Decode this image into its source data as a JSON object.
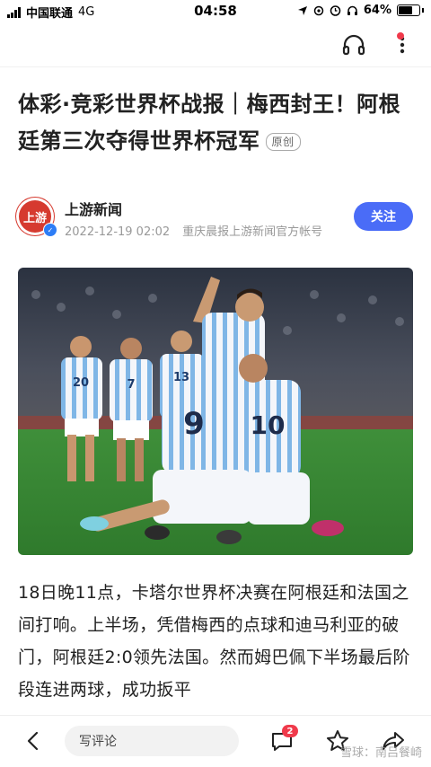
{
  "status_bar": {
    "carrier": "中国联通",
    "network": "4G",
    "time": "04:58",
    "battery": "64%"
  },
  "article": {
    "title": "体彩·竞彩世界杯战报｜梅西封王！阿根廷第三次夺得世界杯冠军",
    "original_tag": "原创",
    "body": "18日晚11点，卡塔尔世界杯决赛在阿根廷和法国之间打响。上半场，凭借梅西的点球和迪马利亚的破门，阿根廷2:0领先法国。然而姆巴佩下半场最后阶段连进两球，成功扳平"
  },
  "author": {
    "avatar_text": "上游",
    "name": "上游新闻",
    "date": "2022-12-19 02:02",
    "description": "重庆晨报上游新闻官方帐号",
    "follow_label": "关注"
  },
  "photo": {
    "jersey_numbers": [
      "20",
      "7",
      "13",
      "9",
      "10"
    ]
  },
  "bottom_bar": {
    "comment_placeholder": "写评论",
    "comment_count": "2",
    "watermark": "雪球：南吕餐崎"
  },
  "colors": {
    "accent": "#4a6cf7",
    "badge": "#f03a4b",
    "avatar": "#d63a2f"
  }
}
